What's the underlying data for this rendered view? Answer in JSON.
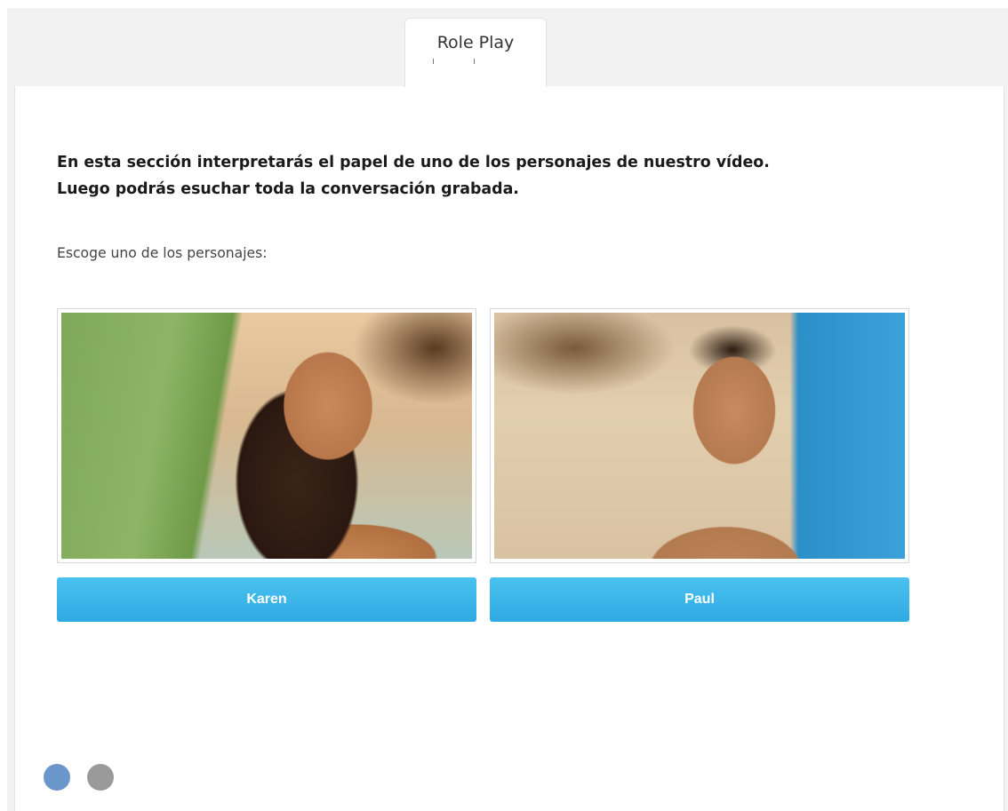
{
  "tab": {
    "label": "Role Play"
  },
  "intro": {
    "line1": "En esta sección interpretarás el papel de uno de los personajes de nuestro vídeo.",
    "line2": "Luego podrás esuchar toda la conversación grabada."
  },
  "prompt": "Escoge uno de los personajes:",
  "characters": [
    {
      "name": "Karen",
      "button_label": "Karen"
    },
    {
      "name": "Paul",
      "button_label": "Paul"
    }
  ],
  "pagination": {
    "total": 2,
    "active_index": 0,
    "active_color": "#6b96cc",
    "inactive_color": "#9a9a9a"
  },
  "colors": {
    "button": "#3ab4ea",
    "background": "#f2f2f2"
  }
}
